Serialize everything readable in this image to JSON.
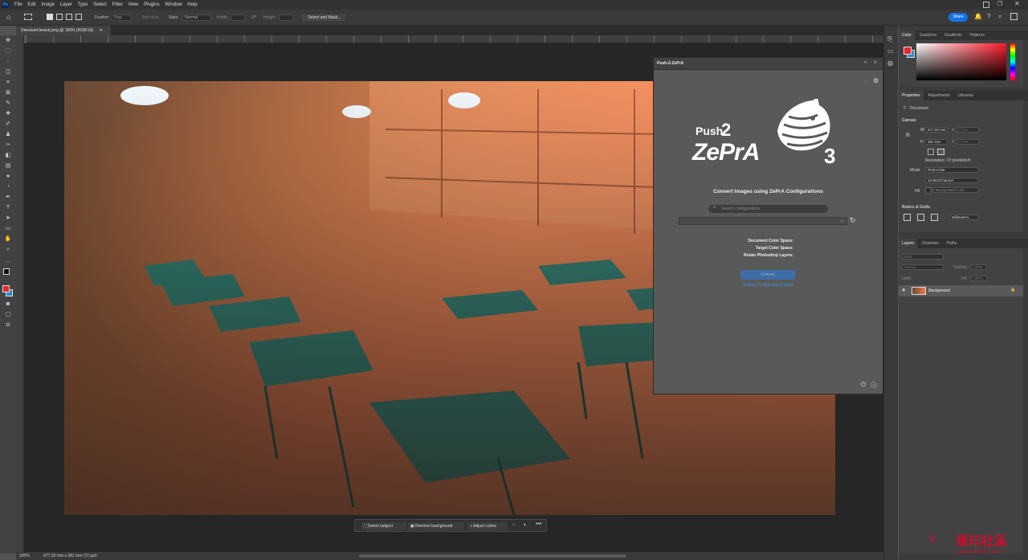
{
  "app": {
    "logo": "Ps",
    "menu": [
      "File",
      "Edit",
      "Image",
      "Layer",
      "Type",
      "Select",
      "Filter",
      "View",
      "Plugins",
      "Window",
      "Help"
    ],
    "share_label": "Share"
  },
  "options": {
    "feather_label": "Feather:",
    "feather_value": "0 px",
    "antialias": "Anti-alias",
    "style_label": "Style:",
    "style_value": "Normal",
    "width_label": "Width:",
    "height_label": "Height:",
    "select_mask": "Select and Mask..."
  },
  "document": {
    "tab_title": "Denoised beauty.png @ 100% (RGB/16)",
    "zoom": "100%",
    "size_info": "677.33 mm x 381 mm (72 ppi)"
  },
  "context_bar": {
    "select_subject": "Select subject",
    "remove_background": "Remove background",
    "adjust_colors": "Adjust colors"
  },
  "plugin": {
    "title": "Push-2-ZePrA",
    "logo_push": "Push",
    "logo_2": "2",
    "logo_zepra": "ZePrA",
    "logo_3": "3",
    "heading": "Convert Images using ZePrA Configurations",
    "search_placeholder": "Search configurations",
    "doc_color_space": "Document Color Space:",
    "target_color_space": "Target Color Space:",
    "retain_layers": "Retain Photoshop Layers:",
    "convert_label": "Convert",
    "error_text": "Getting Configurations failed"
  },
  "color_panel": {
    "tabs": [
      "Color",
      "Swatches",
      "Gradients",
      "Patterns"
    ],
    "fg_color": "#e8262d",
    "bg_color": "#1f8fd6"
  },
  "properties": {
    "tabs": [
      "Properties",
      "Adjustments",
      "Libraries"
    ],
    "doc_label": "Document",
    "canvas_header": "Canvas",
    "w_label": "W",
    "w_value": "677.33 mm",
    "h_label": "H",
    "h_value": "381 mm",
    "x_label": "X",
    "x_value": "0 mm",
    "y_label": "Y",
    "y_value": "0 mm",
    "resolution": "Resolution: 72 pixels/inch",
    "mode_label": "Mode",
    "mode_value": "RGB Color",
    "depth_value": "16 Bits/Channel",
    "fill_label": "Fill",
    "fill_value": "Background Color",
    "rulers_header": "Rulers & Grids",
    "units_value": "Millimeters"
  },
  "layers": {
    "tabs": [
      "Layers",
      "Channels",
      "Paths"
    ],
    "kind_label": "Kind",
    "blend_mode": "Normal",
    "opacity_label": "Opacity:",
    "opacity_value": "100%",
    "lock_label": "Lock:",
    "fill_label": "Fill:",
    "fill_value": "100%",
    "items": [
      {
        "name": "Background"
      }
    ]
  },
  "watermark": {
    "brand": "華印社區",
    "url": "www.52cnp.com"
  }
}
